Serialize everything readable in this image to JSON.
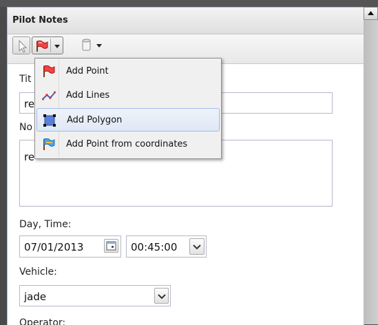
{
  "panel": {
    "title": "Pilot Notes"
  },
  "menu": {
    "items": [
      {
        "label": "Add Point",
        "icon": "red-flag-icon"
      },
      {
        "label": "Add Lines",
        "icon": "lines-icon"
      },
      {
        "label": "Add Polygon",
        "icon": "polygon-icon",
        "active": true
      },
      {
        "label": "Add Point from coordinates",
        "icon": "blue-flag-icon"
      }
    ]
  },
  "form": {
    "title_label": "Tit",
    "title_value": "re",
    "notes_label": "No",
    "notes_value": "re",
    "day_time_label": "Day, Time:",
    "date_value": "07/01/2013",
    "time_value": "00:45:00",
    "vehicle_label": "Vehicle:",
    "vehicle_value": "jade",
    "operator_label": "Operator:"
  },
  "colors": {
    "panel_border": "#99bbe8",
    "menu_active_border": "#a3bae9"
  }
}
